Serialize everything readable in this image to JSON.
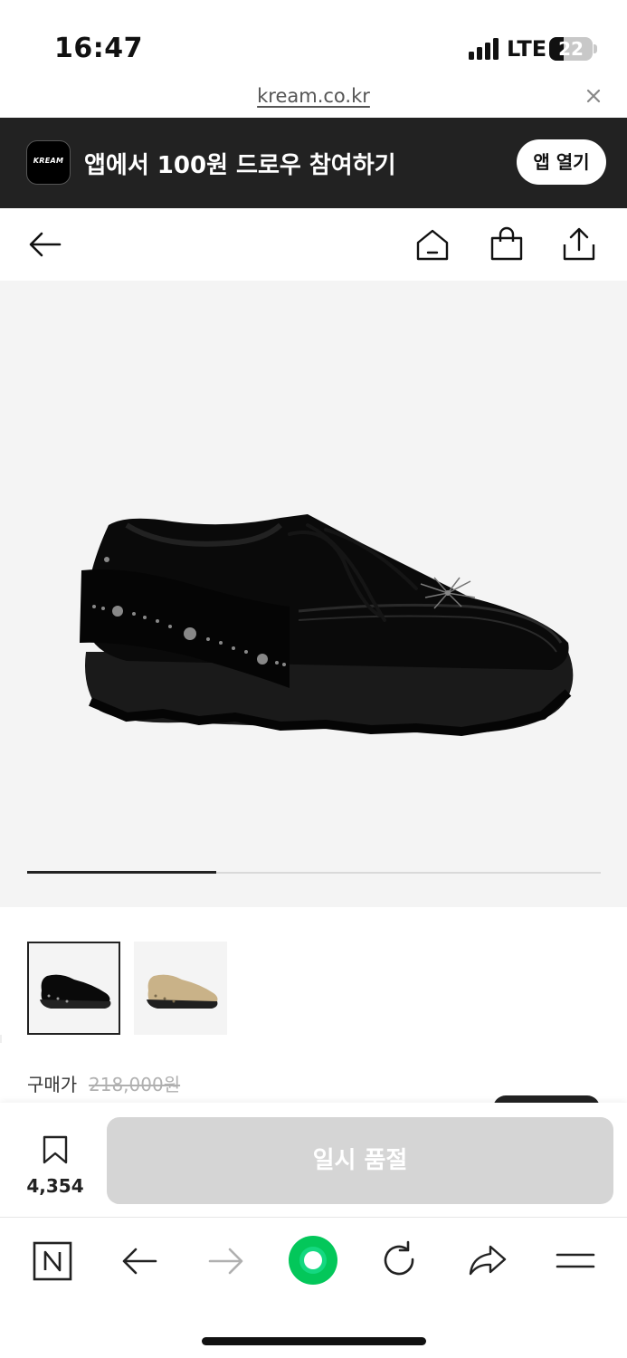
{
  "status_bar": {
    "time": "16:47",
    "network": "LTE",
    "battery": "22"
  },
  "url_bar": {
    "url": "kream.co.kr"
  },
  "app_banner": {
    "logo_text": "KREAM",
    "message": "앱에서 100원 드로우 참여하기",
    "open_button": "앱 열기"
  },
  "nav": {
    "icons": [
      "back-arrow-icon",
      "home-icon",
      "shopping-bag-icon",
      "share-icon"
    ]
  },
  "gallery": {
    "image_progress": 0.33,
    "thumbnails": [
      {
        "color": "black",
        "selected": true
      },
      {
        "color": "beige",
        "selected": false
      }
    ]
  },
  "price": {
    "label": "구매가",
    "original_price": "218,000원"
  },
  "action_bar": {
    "bookmark_count": "4,354",
    "soldout_button": "일시 품절"
  },
  "colors": {
    "banner_bg": "#222222",
    "gallery_bg": "#f4f4f4",
    "soldout_bg": "#d5d5d5",
    "naver_green": "#03c75a"
  },
  "browser_toolbar": {
    "icons": [
      "naver-n-icon",
      "back-icon",
      "forward-icon",
      "green-dot-icon",
      "refresh-icon",
      "share-icon",
      "menu-icon"
    ]
  }
}
